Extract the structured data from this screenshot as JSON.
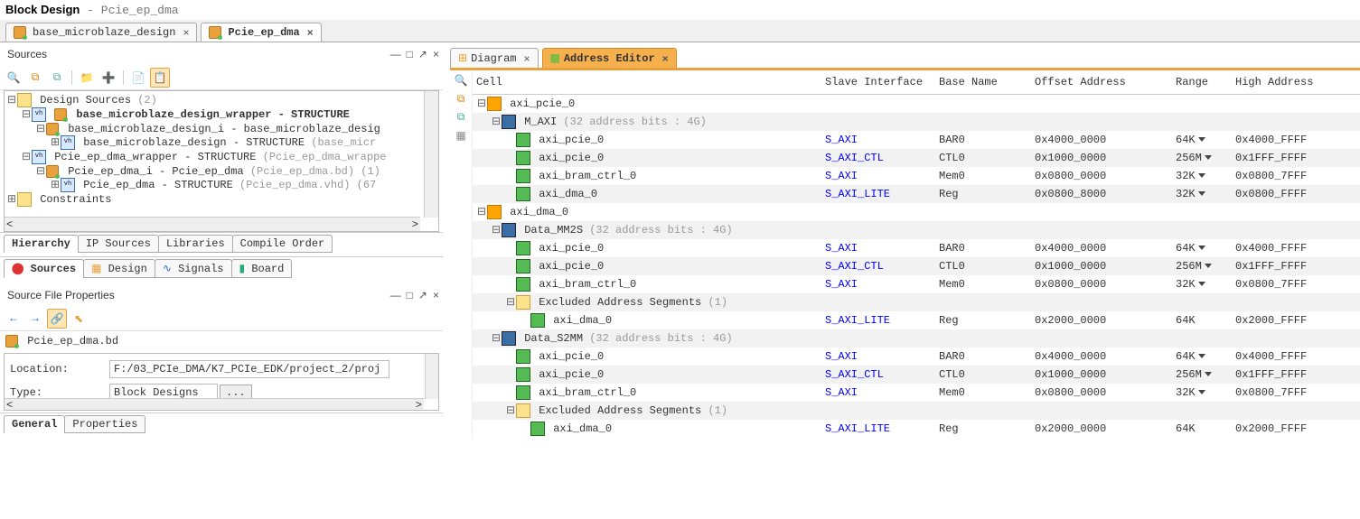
{
  "title": {
    "main": "Block Design",
    "sub": " - Pcie_ep_dma"
  },
  "mainTabs": [
    {
      "label": "base_microblaze_design",
      "active": false
    },
    {
      "label": "Pcie_ep_dma",
      "active": true
    }
  ],
  "sources": {
    "title": "Sources",
    "tree": {
      "root_label": "Design Sources",
      "root_count": "(2)",
      "n1_label": "base_microblaze_design_wrapper",
      "n1_suffix": " - STRUCTURE",
      "n1a_label": "base_microblaze_design_i - base_microblaze_desig",
      "n1a1_label": "base_microblaze_design - STRUCTURE",
      "n1a1_paren": "(base_micr",
      "n2_label": "Pcie_ep_dma_wrapper - STRUCTURE",
      "n2_paren": "(Pcie_ep_dma_wrappe",
      "n2a_label": "Pcie_ep_dma_i - Pcie_ep_dma",
      "n2a_paren": "(Pcie_ep_dma.bd) (1)",
      "n2a1_label": "Pcie_ep_dma - STRUCTURE",
      "n2a1_paren": "(Pcie_ep_dma.vhd) (67",
      "constraints": "Constraints"
    },
    "bottomTabs1": [
      "Hierarchy",
      "IP Sources",
      "Libraries",
      "Compile Order"
    ],
    "bottomTabs2": [
      {
        "label": "Sources",
        "icon": "src",
        "active": true
      },
      {
        "label": "Design",
        "icon": "des"
      },
      {
        "label": "Signals",
        "icon": "sig"
      },
      {
        "label": "Board",
        "icon": "brd"
      }
    ]
  },
  "props": {
    "title": "Source File Properties",
    "file": "Pcie_ep_dma.bd",
    "locationLabel": "Location:",
    "locationVal": "F:/03_PCIe_DMA/K7_PCIe_EDK/project_2/proj",
    "typeLabel": "Type:",
    "typeVal": "Block Designs",
    "typeBtn": "...",
    "tabs": [
      "General",
      "Properties"
    ]
  },
  "docTabs": [
    {
      "label": "Diagram",
      "active": false
    },
    {
      "label": "Address Editor",
      "active": true
    }
  ],
  "addr": {
    "headers": [
      "Cell",
      "Slave Interface",
      "Base Name",
      "Offset Address",
      "Range",
      "High Address"
    ],
    "rows": [
      {
        "indent": 0,
        "type": "chip",
        "cell": "axi_pcie_0"
      },
      {
        "indent": 1,
        "type": "grid",
        "cell": "M_AXI",
        "note": "(32 address bits : 4G)"
      },
      {
        "indent": 2,
        "type": "seg",
        "cell": "axi_pcie_0",
        "si": "S_AXI",
        "bn": "BAR0",
        "off": "0x4000_0000",
        "range": "64K",
        "tri": true,
        "hi": "0x4000_FFFF"
      },
      {
        "indent": 2,
        "type": "seg",
        "cell": "axi_pcie_0",
        "si": "S_AXI_CTL",
        "bn": "CTL0",
        "off": "0x1000_0000",
        "range": "256M",
        "tri": true,
        "hi": "0x1FFF_FFFF"
      },
      {
        "indent": 2,
        "type": "seg",
        "cell": "axi_bram_ctrl_0",
        "si": "S_AXI",
        "bn": "Mem0",
        "off": "0x0800_0000",
        "range": "32K",
        "tri": true,
        "hi": "0x0800_7FFF"
      },
      {
        "indent": 2,
        "type": "seg",
        "cell": "axi_dma_0",
        "si": "S_AXI_LITE",
        "bn": "Reg",
        "off": "0x0800_8000",
        "range": "32K",
        "tri": true,
        "hi": "0x0800_FFFF"
      },
      {
        "indent": 0,
        "type": "chip",
        "cell": "axi_dma_0"
      },
      {
        "indent": 1,
        "type": "grid",
        "cell": "Data_MM2S",
        "note": "(32 address bits : 4G)"
      },
      {
        "indent": 2,
        "type": "seg",
        "cell": "axi_pcie_0",
        "si": "S_AXI",
        "bn": "BAR0",
        "off": "0x4000_0000",
        "range": "64K",
        "tri": true,
        "hi": "0x4000_FFFF"
      },
      {
        "indent": 2,
        "type": "seg",
        "cell": "axi_pcie_0",
        "si": "S_AXI_CTL",
        "bn": "CTL0",
        "off": "0x1000_0000",
        "range": "256M",
        "tri": true,
        "hi": "0x1FFF_FFFF"
      },
      {
        "indent": 2,
        "type": "seg",
        "cell": "axi_bram_ctrl_0",
        "si": "S_AXI",
        "bn": "Mem0",
        "off": "0x0800_0000",
        "range": "32K",
        "tri": true,
        "hi": "0x0800_7FFF"
      },
      {
        "indent": 2,
        "type": "folder",
        "cell": "Excluded Address Segments",
        "note": "(1)"
      },
      {
        "indent": 3,
        "type": "seg",
        "cell": "axi_dma_0",
        "si": "S_AXI_LITE",
        "bn": "Reg",
        "off": "0x2000_0000",
        "range": "64K",
        "tri": false,
        "hi": "0x2000_FFFF"
      },
      {
        "indent": 1,
        "type": "grid",
        "cell": "Data_S2MM",
        "note": "(32 address bits : 4G)"
      },
      {
        "indent": 2,
        "type": "seg",
        "cell": "axi_pcie_0",
        "si": "S_AXI",
        "bn": "BAR0",
        "off": "0x4000_0000",
        "range": "64K",
        "tri": true,
        "hi": "0x4000_FFFF"
      },
      {
        "indent": 2,
        "type": "seg",
        "cell": "axi_pcie_0",
        "si": "S_AXI_CTL",
        "bn": "CTL0",
        "off": "0x1000_0000",
        "range": "256M",
        "tri": true,
        "hi": "0x1FFF_FFFF"
      },
      {
        "indent": 2,
        "type": "seg",
        "cell": "axi_bram_ctrl_0",
        "si": "S_AXI",
        "bn": "Mem0",
        "off": "0x0800_0000",
        "range": "32K",
        "tri": true,
        "hi": "0x0800_7FFF"
      },
      {
        "indent": 2,
        "type": "folder",
        "cell": "Excluded Address Segments",
        "note": "(1)"
      },
      {
        "indent": 3,
        "type": "seg",
        "cell": "axi_dma_0",
        "si": "S_AXI_LITE",
        "bn": "Reg",
        "off": "0x2000_0000",
        "range": "64K",
        "tri": false,
        "hi": "0x2000_FFFF"
      }
    ]
  }
}
